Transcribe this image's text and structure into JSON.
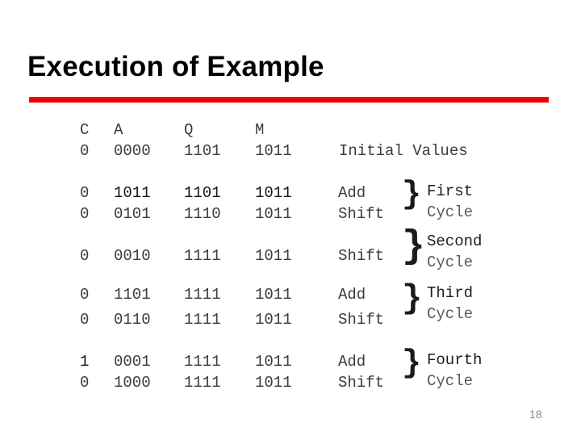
{
  "slide": {
    "title": "Execution of Example",
    "page_number": "18",
    "accent_color": "#f40000"
  },
  "table": {
    "headers": {
      "c": "C",
      "a": "A",
      "q": "Q",
      "m": "M"
    },
    "initial": {
      "c": "0",
      "a": "0000",
      "q": "1101",
      "m": "1011",
      "note": "Initial Values"
    },
    "cycles": [
      {
        "label_line1": "First",
        "label_line2": "Cycle",
        "rows": [
          {
            "c": "0",
            "a": "1011",
            "q": "1101",
            "m": "1011",
            "op": "Add"
          },
          {
            "c": "0",
            "a": "0101",
            "q": "1110",
            "m": "1011",
            "op": "Shift"
          }
        ]
      },
      {
        "label_line1": "Second",
        "label_line2": "Cycle",
        "rows": [
          {
            "c": "0",
            "a": "0010",
            "q": "1111",
            "m": "1011",
            "op": "Shift"
          }
        ]
      },
      {
        "label_line1": "Third",
        "label_line2": "Cycle",
        "rows": [
          {
            "c": "0",
            "a": "1101",
            "q": "1111",
            "m": "1011",
            "op": "Add"
          },
          {
            "c": "0",
            "a": "0110",
            "q": "1111",
            "m": "1011",
            "op": "Shift"
          }
        ]
      },
      {
        "label_line1": "Fourth",
        "label_line2": "Cycle",
        "rows": [
          {
            "c": "1",
            "a": "0001",
            "q": "1111",
            "m": "1011",
            "op": "Add"
          },
          {
            "c": "0",
            "a": "1000",
            "q": "1111",
            "m": "1011",
            "op": "Shift"
          }
        ]
      }
    ],
    "brace_glyph": "}"
  }
}
